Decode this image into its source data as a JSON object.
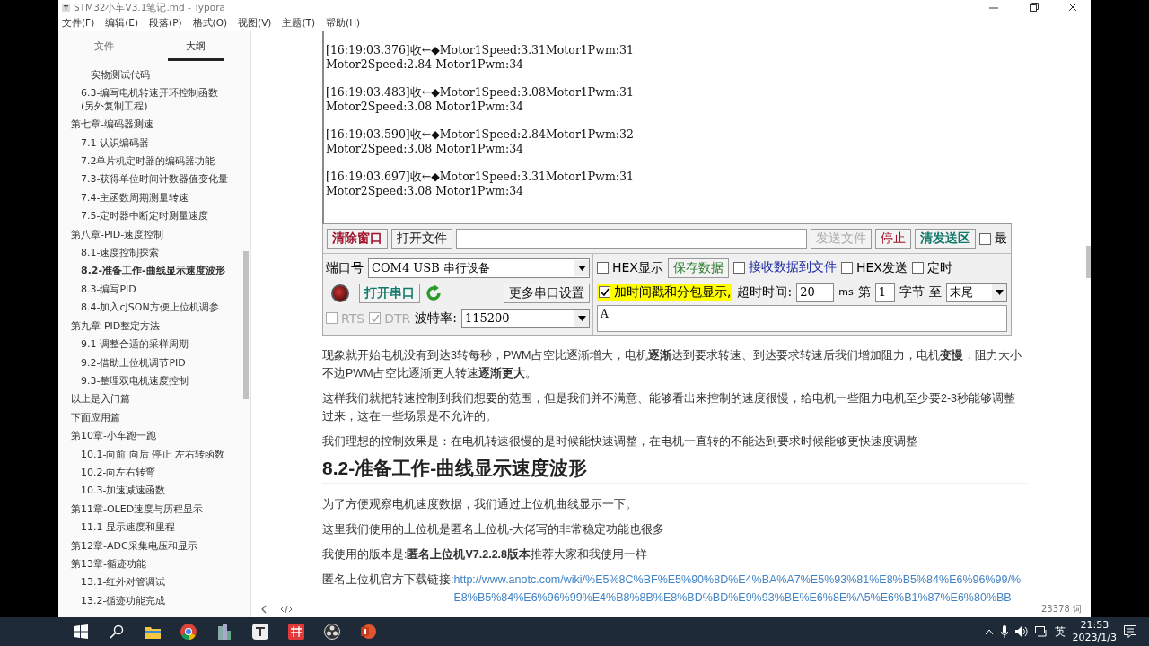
{
  "window": {
    "title": "STM32小车V3.1笔记.md - Typora",
    "menu": [
      "文件(F)",
      "编辑(E)",
      "段落(P)",
      "格式(O)",
      "视图(V)",
      "主题(T)",
      "帮助(H)"
    ]
  },
  "sidebar": {
    "tabs": [
      {
        "label": "文件",
        "selected": false
      },
      {
        "label": "大纲",
        "selected": true
      }
    ],
    "outline": [
      {
        "children": [
          {
            "children": [
              {
                "label": "实物测试代码",
                "selected": false
              }
            ]
          },
          {
            "label": "6.3-编写电机转速开环控制函数(另外复制工程)",
            "selected": false
          }
        ]
      },
      {
        "label": "第七章-编码器测速",
        "selected": false,
        "children": [
          {
            "label": "7.1-认识编码器",
            "selected": false
          },
          {
            "label": "7.2单片机定时器的编码器功能",
            "selected": false
          },
          {
            "label": "7.3-获得单位时间计数器值变化量",
            "selected": false
          },
          {
            "label": "7.4-主函数周期测量转速",
            "selected": false
          },
          {
            "label": "7.5-定时器中断定时测量速度",
            "selected": false
          }
        ]
      },
      {
        "label": "第八章-PID-速度控制",
        "selected": false,
        "children": [
          {
            "label": "8.1-速度控制探索",
            "selected": false
          },
          {
            "label": "8.2-准备工作-曲线显示速度波形",
            "selected": true
          },
          {
            "label": "8.3-编写PID",
            "selected": false
          },
          {
            "label": "8.4-加入cJSON方便上位机调参",
            "selected": false
          }
        ]
      },
      {
        "label": "第九章-PID整定方法",
        "selected": false,
        "children": [
          {
            "label": "9.1-调整合适的采样周期",
            "selected": false
          },
          {
            "label": "9.2-借助上位机调节PID",
            "selected": false
          },
          {
            "label": "9.3-整理双电机速度控制",
            "selected": false
          }
        ]
      },
      {
        "label": "以上是入门篇",
        "selected": false
      },
      {
        "label": "下面应用篇",
        "selected": false
      },
      {
        "label": "第10章-小车跑一跑",
        "selected": false,
        "children": [
          {
            "label": "10.1-向前 向后 停止 左右转函数",
            "selected": false
          },
          {
            "label": "10.2-向左右转弯",
            "selected": false
          },
          {
            "label": "10.3-加速减速函数",
            "selected": false
          }
        ]
      },
      {
        "label": "第11章-OLED速度与历程显示",
        "selected": false,
        "children": [
          {
            "label": "11.1-显示速度和里程",
            "selected": false
          }
        ]
      },
      {
        "label": "第12章-ADC采集电压和显示",
        "selected": false
      },
      {
        "label": "第13章-循迹功能",
        "selected": false,
        "children": [
          {
            "label": "13.1-红外对管调试",
            "selected": false
          },
          {
            "label": "13.2-循迹功能完成",
            "selected": false
          }
        ]
      }
    ]
  },
  "serial": {
    "log": [
      {
        "line_1": "[16:19:03.376]收←◆Motor1Speed:3.31Motor1Pwm:31",
        "line_2": "Motor2Speed:2.84 Motor1Pwm:34"
      },
      {
        "line_1": "[16:19:03.483]收←◆Motor1Speed:3.08Motor1Pwm:31",
        "line_2": "Motor2Speed:3.08 Motor1Pwm:34"
      },
      {
        "line_1": "[16:19:03.590]收←◆Motor1Speed:2.84Motor1Pwm:32",
        "line_2": "Motor2Speed:3.08 Motor1Pwm:34"
      },
      {
        "line_1": "[16:19:03.697]收←◆Motor1Speed:3.31Motor1Pwm:31",
        "line_2": "Motor2Speed:3.08 Motor1Pwm:34"
      }
    ],
    "toolbar": {
      "clear": "清除窗口",
      "open_file": "打开文件",
      "send_file": "发送文件",
      "stop": "停止",
      "clear_send": "清发送区",
      "topmost": {
        "label": "最",
        "checked": false
      }
    },
    "port_label": "端口号",
    "port": "COM4 USB 串行设备",
    "open_port": "打开串口",
    "more_settings": "更多串口设置",
    "rts": {
      "label": "RTS",
      "checked": false
    },
    "dtr": {
      "label": "DTR",
      "checked": true
    },
    "baud_label": "波特率:",
    "baud": "115200",
    "hex_display": {
      "label": "HEX显示",
      "checked": false
    },
    "save_data": "保存数据",
    "receive_to_file": {
      "label": "接收数据到文件",
      "checked": false
    },
    "hex_send": {
      "label": "HEX发送",
      "checked": false
    },
    "timed_send": {
      "label": "定时",
      "checked": false
    },
    "timestamp": {
      "label": "加时间戳和分包显示,",
      "checked": true
    },
    "timeout_label": "超时时间:",
    "timeout": "20",
    "ms": "ms",
    "nth": "第",
    "byte_index": "1",
    "bytes": "字节",
    "to": "至",
    "end": "末尾",
    "send_text": "A"
  },
  "article": {
    "paragraphs_1": [
      "现象就开始电机没有到达3转每秒，PWM占空比逐渐增大，电机**逐渐**达到要求转速、到达要求转速后我们增加阻力，电机**变慢**，阻力大小不边PWM占空比逐渐更大转速**逐渐更大**。",
      "这样我们就把转速控制到我们想要的范围，但是我们并不满意、能够看出来控制的速度很慢，给电机一些阻力电机至少要2-3秒能够调整过来，这在一些场景是不允许的。",
      "我们理想的控制效果是：在电机转速很慢的是时候能快速调整，在电机一直转的不能达到要求时候能够更快速度调整"
    ],
    "heading": "8.2-准备工作-曲线显示速度波形",
    "paragraphs_2": [
      "为了方便观察电机速度数据，我们通过上位机曲线显示一下。",
      "这里我们使用的上位机是匿名上位机-大佬写的非常稳定功能也很多",
      "我使用的版本是:**匿名上位机V7.2.2.8版本**推荐大家和我使用一样"
    ],
    "link_label": "匿名上位机官方下载链接:",
    "link": "http://www.anotc.com/wiki/%E5%8C%BF%E5%90%8D%E4%BA%A7%E5%93%81%E8%B5%84%E6%96%99/%E8%B5%84%E6%96%99%E4%B8%8B%E8%BD%BD%E9%93%BE%E6%8E%A5%E6%B1%87%E6%80%BB"
  },
  "status_bar": {
    "word_count": "23378 词"
  },
  "taskbar": {
    "ime": "英",
    "time": "21:53",
    "date": "2023/1/3"
  }
}
